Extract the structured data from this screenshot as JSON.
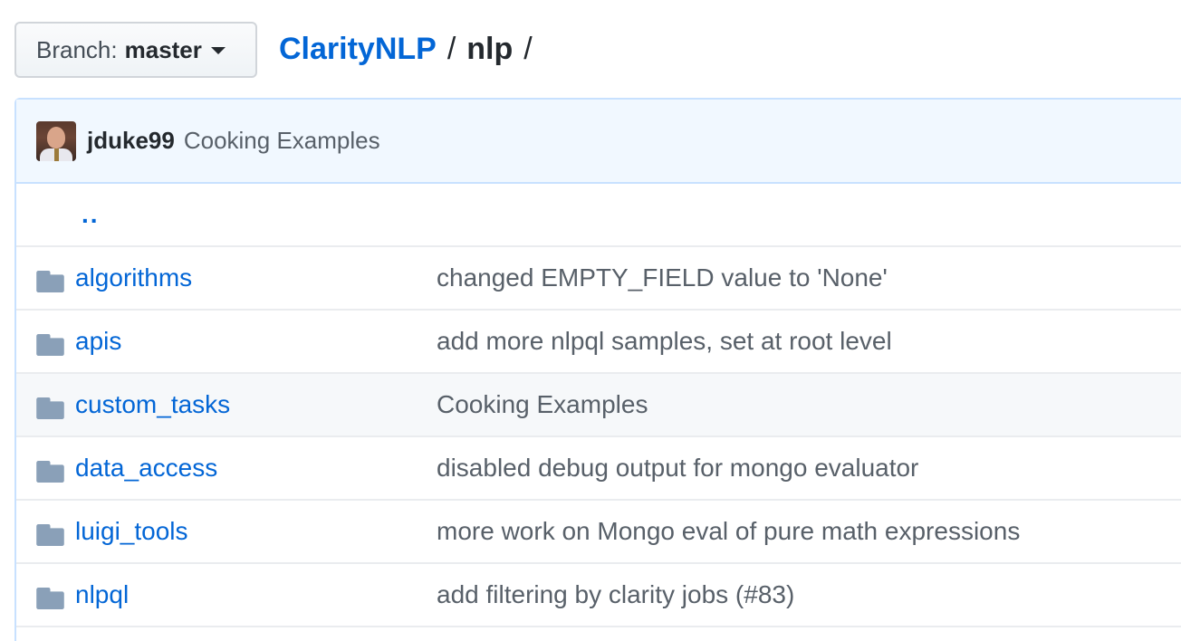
{
  "branch": {
    "label": "Branch:",
    "value": "master"
  },
  "breadcrumb": {
    "repo": "ClarityNLP",
    "sep1": "/",
    "dir": "nlp",
    "sep2": "/"
  },
  "commit": {
    "author": "jduke99",
    "message": "Cooking Examples"
  },
  "parent_dir": "..",
  "files": [
    {
      "name": "algorithms",
      "message": "changed EMPTY_FIELD value to 'None'",
      "type": "folder"
    },
    {
      "name": "apis",
      "message": "add more nlpql samples, set at root level",
      "type": "folder"
    },
    {
      "name": "custom_tasks",
      "message": "Cooking Examples",
      "type": "folder"
    },
    {
      "name": "data_access",
      "message": "disabled debug output for mongo evaluator",
      "type": "folder"
    },
    {
      "name": "luigi_tools",
      "message": "more work on Mongo eval of pure math expressions",
      "type": "folder"
    },
    {
      "name": "nlpql",
      "message": "add filtering by clarity jobs (#83)",
      "type": "folder"
    }
  ],
  "colors": {
    "link": "#0366d6",
    "folder": "#79b8ff",
    "muted": "#586069",
    "tease_bg": "#f1f8ff"
  }
}
